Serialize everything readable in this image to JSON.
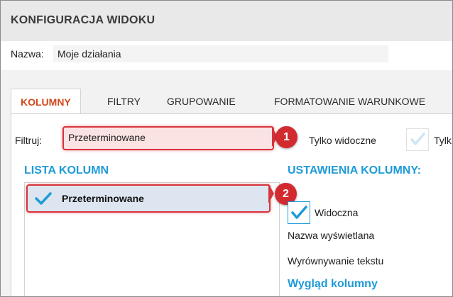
{
  "window": {
    "title": "KONFIGURACJA WIDOKU"
  },
  "name_field": {
    "label": "Nazwa:",
    "value": "Moje działania"
  },
  "tabs": [
    {
      "label": "KOLUMNY",
      "active": true
    },
    {
      "label": "FILTRY",
      "active": false
    },
    {
      "label": "GRUPOWANIE",
      "active": false
    },
    {
      "label": "FORMATOWANIE WARUNKOWE",
      "active": false
    }
  ],
  "filter": {
    "label": "Filtruj:",
    "value": "Przeterminowane"
  },
  "only_visible": {
    "label": "Tylko widoczne"
  },
  "second_checkbox": {
    "label": "Tylk"
  },
  "markers": {
    "one": "1",
    "two": "2"
  },
  "column_list": {
    "title": "LISTA KOLUMN",
    "items": [
      {
        "label": "Przeterminowane",
        "checked": true
      }
    ]
  },
  "column_settings": {
    "title": "USTAWIENIA KOLUMNY:",
    "visible_label": "Widoczna",
    "visible_checked": true,
    "display_name_label": "Nazwa wyświetlana",
    "text_alignment_label": "Wyrównywanie tekstu",
    "appearance_title": "Wygląd kolumny"
  },
  "colors": {
    "accent_blue": "#1e9bd7",
    "active_tab": "#d14a1b",
    "highlight_red": "#d8323a",
    "marker_red": "#d22a2f"
  }
}
